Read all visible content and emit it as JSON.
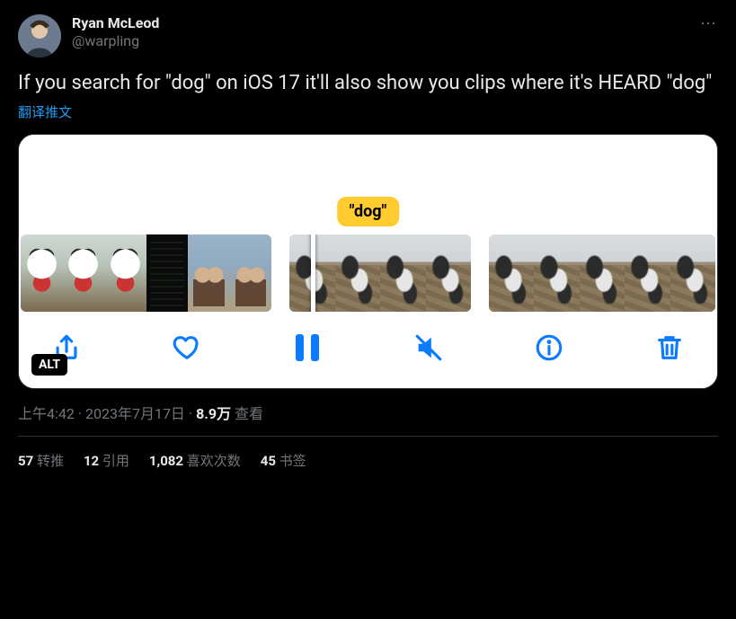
{
  "author": {
    "display_name": "Ryan McLeod",
    "handle": "@warpling"
  },
  "tweet_text": "If you search for \"dog\" on iOS 17 it'll also show you clips where it's HEARD \"dog\"",
  "translate_label": "翻译推文",
  "media": {
    "badge": "\"dog\"",
    "alt_label": "ALT"
  },
  "meta": {
    "time": "上午4:42",
    "date": "2023年7月17日",
    "sep": " · ",
    "views_number": "8.9万",
    "views_label": " 查看"
  },
  "stats": {
    "retweets": {
      "count": "57",
      "label": " 转推"
    },
    "quotes": {
      "count": "12",
      "label": " 引用"
    },
    "likes": {
      "count": "1,082",
      "label": " 喜欢次数"
    },
    "bookmarks": {
      "count": "45",
      "label": " 书签"
    }
  },
  "icons": {
    "more": "⋯"
  }
}
